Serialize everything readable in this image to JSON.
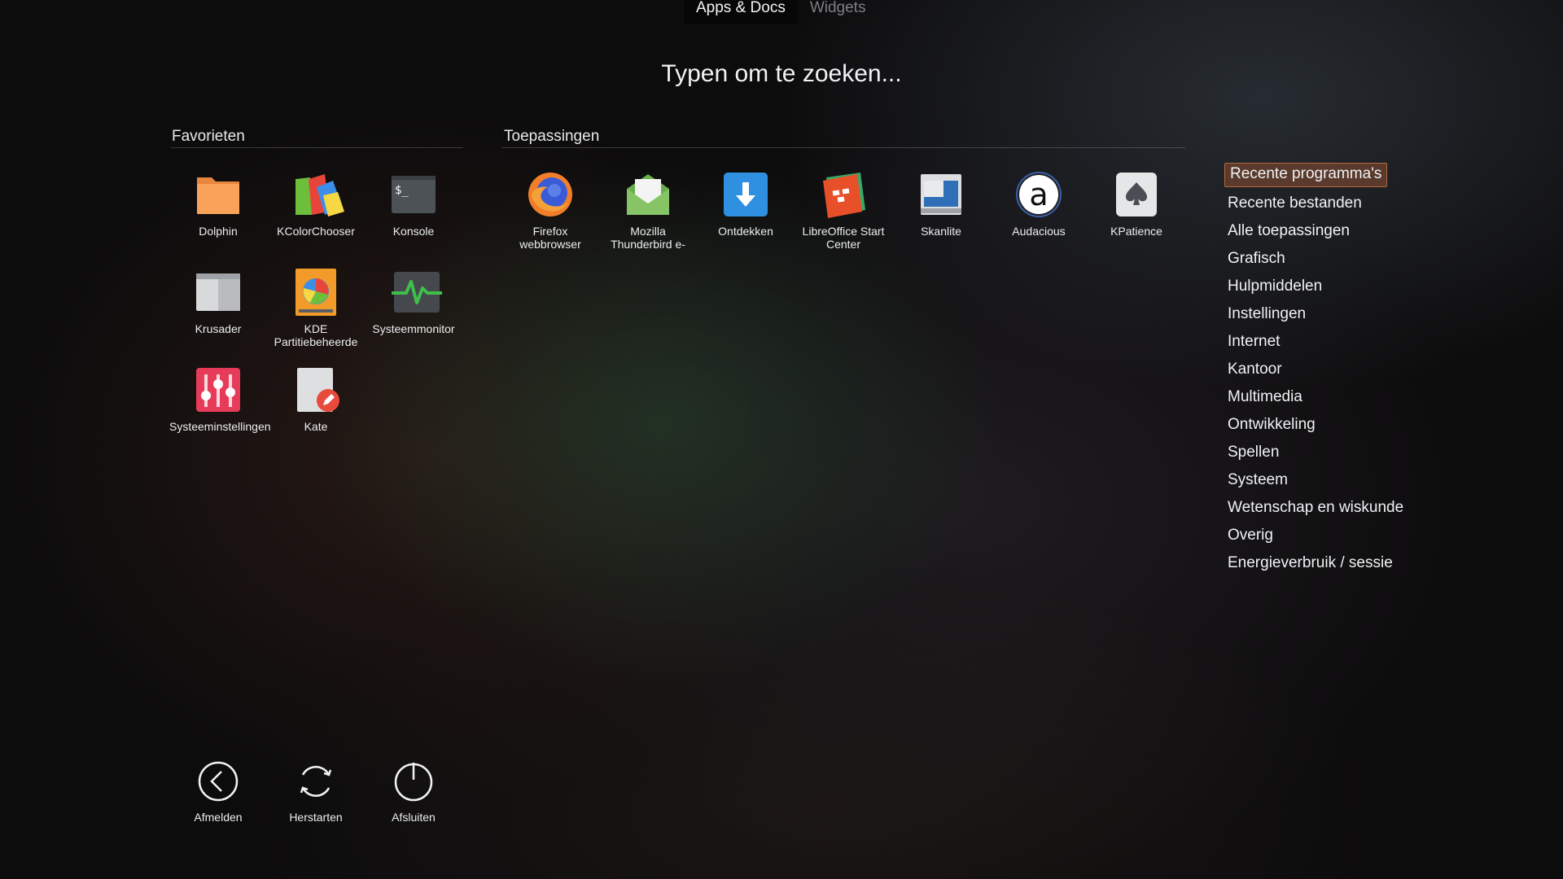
{
  "tabs": {
    "apps_docs": "Apps & Docs",
    "widgets": "Widgets"
  },
  "search": {
    "placeholder": "Typen om te zoeken..."
  },
  "favorites": {
    "title": "Favorieten",
    "items": [
      {
        "label": "Dolphin",
        "icon": "folder-icon"
      },
      {
        "label": "KColorChooser",
        "icon": "color-chooser-icon"
      },
      {
        "label": "Konsole",
        "icon": "terminal-icon"
      },
      {
        "label": "Krusader",
        "icon": "file-manager-icon"
      },
      {
        "label": "KDE Partitiebeheerde",
        "icon": "partition-manager-icon"
      },
      {
        "label": "Systeemmonitor",
        "icon": "system-monitor-icon"
      },
      {
        "label": "Systeeminstellingen",
        "icon": "settings-sliders-icon"
      },
      {
        "label": "Kate",
        "icon": "text-editor-icon"
      }
    ]
  },
  "applications": {
    "title": "Toepassingen",
    "items": [
      {
        "label": "Firefox webbrowser",
        "icon": "firefox-icon"
      },
      {
        "label": "Mozilla Thunderbird e-",
        "icon": "mail-icon"
      },
      {
        "label": "Ontdekken",
        "icon": "download-icon"
      },
      {
        "label": "LibreOffice Start Center",
        "icon": "libreoffice-icon"
      },
      {
        "label": "Skanlite",
        "icon": "scanner-icon"
      },
      {
        "label": "Audacious",
        "icon": "audacious-icon"
      },
      {
        "label": "KPatience",
        "icon": "spade-card-icon"
      }
    ]
  },
  "categories": [
    "Recente programma's",
    "Recente bestanden",
    "Alle toepassingen",
    "Grafisch",
    "Hulpmiddelen",
    "Instellingen",
    "Internet",
    "Kantoor",
    "Multimedia",
    "Ontwikkeling",
    "Spellen",
    "Systeem",
    "Wetenschap en wiskunde",
    "Overig",
    "Energieverbruik / sessie"
  ],
  "power": {
    "logout": "Afmelden",
    "restart": "Herstarten",
    "shutdown": "Afsluiten"
  },
  "colors": {
    "selected_bg": "#5a3a2c",
    "selected_border": "#b8673f"
  }
}
